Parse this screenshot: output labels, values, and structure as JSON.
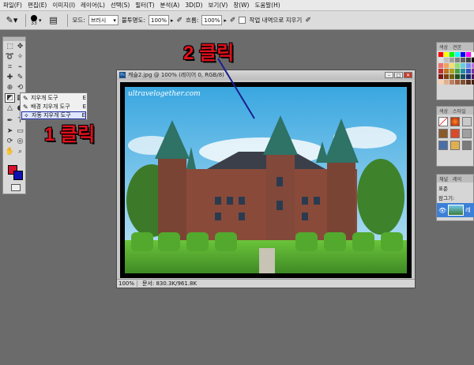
{
  "menubar": {
    "items": [
      "파일(F)",
      "편집(E)",
      "이미지(I)",
      "레이어(L)",
      "선택(S)",
      "필터(T)",
      "분석(A)",
      "3D(D)",
      "보기(V)",
      "창(W)",
      "도움말(H)"
    ]
  },
  "options": {
    "brush_size": "33",
    "mode_label": "모드:",
    "mode_value": "브러시",
    "opacity_label": "불투명도:",
    "opacity_value": "100%",
    "flow_label": "흐름:",
    "flow_value": "100%",
    "erase_history_label": "작업 내역으로 지우기"
  },
  "flyout": {
    "items": [
      {
        "label": "지우개 도구",
        "key": "E"
      },
      {
        "label": "배경 지우개 도구",
        "key": "E"
      },
      {
        "label": "자동 지우개 도구",
        "key": "E"
      }
    ]
  },
  "annotations": {
    "step1": "1 클릭",
    "step2": "2 클릭"
  },
  "document": {
    "title": "캐슬2.jpg @ 100% (레이어 0, RGB/8) *",
    "watermark": "ultravelogether.com",
    "zoom": "100%",
    "status_info": "문서: 830.3K/961.8K"
  },
  "panels": {
    "swatches_tabs": [
      "색상",
      "견본"
    ],
    "styles_tabs": [
      "색상",
      "스타일"
    ],
    "layers_tabs": [
      "채널",
      "레이"
    ],
    "layers_mode": "표준",
    "layers_lock_label": "잠그기:",
    "layer_name": "레"
  },
  "colors": {
    "foreground": "#d8102f",
    "background": "#1010b0",
    "annotation": "#e0101c",
    "selection": "#1a2aa0"
  }
}
